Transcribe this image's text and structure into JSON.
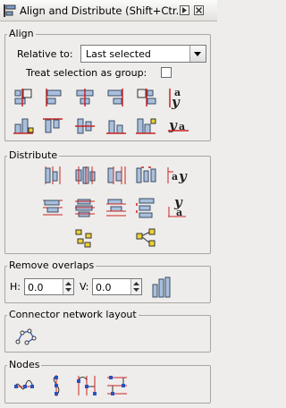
{
  "title": "Align and Distribute (Shift+Ctr...",
  "sections": {
    "align": "Align",
    "distribute": "Distribute",
    "remove_overlaps": "Remove overlaps",
    "connector": "Connector network layout",
    "nodes": "Nodes"
  },
  "align": {
    "relative_label": "Relative to:",
    "relative_value": "Last selected",
    "group_label": "Treat selection as group:",
    "group_checked": false
  },
  "overlaps": {
    "h_label": "H:",
    "h_value": "0.0",
    "v_label": "V:",
    "v_value": "0.0"
  },
  "colors": {
    "bar": "#a9c0dc",
    "bar_stroke": "#3a4a66",
    "guide": "#cc2222",
    "node_fill": "#f0d030",
    "node_blue": "#2a52c0"
  }
}
